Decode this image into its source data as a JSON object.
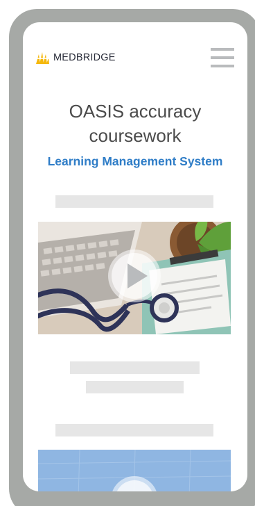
{
  "brand": {
    "name": "MEDBRIDGE",
    "accent": "#f5b80d"
  },
  "header": {
    "menu_icon": "hamburger-menu-icon"
  },
  "hero": {
    "title": "OASIS accuracy coursework",
    "subtitle": "Learning Management System"
  },
  "colors": {
    "subtitle": "#2f7dc7",
    "frame": "#a6a9a6",
    "accent_blob": "#c0653d",
    "placeholder": "#e6e6e6"
  },
  "media": [
    {
      "icon": "play-icon",
      "image": "laptop-stethoscope-illustration"
    },
    {
      "icon": "play-icon",
      "image": "blueprint-illustration"
    }
  ]
}
